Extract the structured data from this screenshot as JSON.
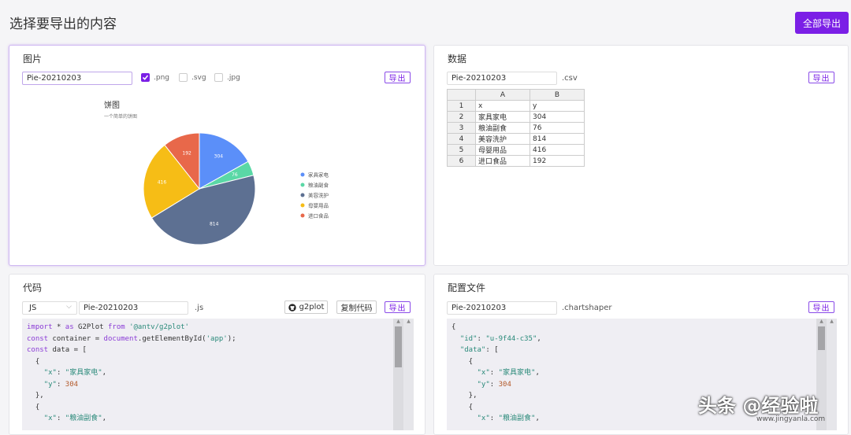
{
  "page_title": "选择要导出的内容",
  "export_all": "全部导出",
  "image_panel": {
    "title": "图片",
    "filename": "Pie-20210203",
    "formats": [
      {
        "label": ".png",
        "checked": true
      },
      {
        "label": ".svg",
        "checked": false
      },
      {
        "label": ".jpg",
        "checked": false
      }
    ],
    "export": "导出"
  },
  "data_panel": {
    "title": "数据",
    "filename": "Pie-20210203",
    "ext": ".csv",
    "export": "导出",
    "columns": [
      "A",
      "B"
    ],
    "rows": [
      [
        "1",
        "x",
        "y"
      ],
      [
        "2",
        "家具家电",
        "304"
      ],
      [
        "3",
        "粮油副食",
        "76"
      ],
      [
        "4",
        "美容洗护",
        "814"
      ],
      [
        "5",
        "母婴用品",
        "416"
      ],
      [
        "6",
        "进口食品",
        "192"
      ]
    ]
  },
  "code_panel": {
    "title": "代码",
    "language": "JS",
    "filename": "Pie-20210203",
    "ext": ".js",
    "g2plot": "g2plot",
    "copy": "复制代码",
    "export": "导出"
  },
  "config_panel": {
    "title": "配置文件",
    "filename": "Pie-20210203",
    "ext": ".chartshaper",
    "export": "导出"
  },
  "chart_data": {
    "type": "pie",
    "title": "饼图",
    "subtitle": "一个简单的饼图",
    "categories": [
      "家具家电",
      "粮油副食",
      "美容洗护",
      "母婴用品",
      "进口食品"
    ],
    "values": [
      304,
      76,
      814,
      416,
      192
    ],
    "colors": [
      "#5b8ff9",
      "#5ad8a6",
      "#5d7092",
      "#f6bd16",
      "#e8684a"
    ],
    "legend": "right"
  },
  "watermark": {
    "text": "头条 @经验啦",
    "sub": "www.jingyanla.com"
  }
}
